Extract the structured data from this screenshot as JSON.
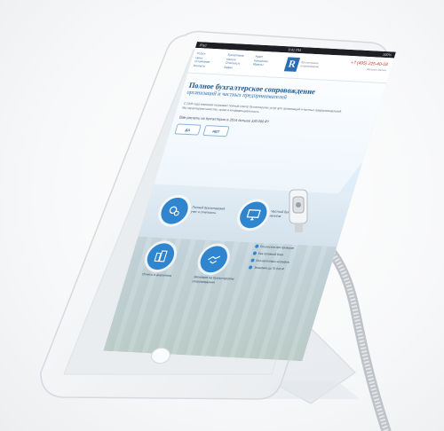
{
  "status_bar": {
    "carrier": "iPad",
    "time": "9:41 PM",
    "battery": "100%"
  },
  "nav": {
    "col1": [
      "Услуги",
      "Цены",
      "О компании",
      "Контакты"
    ],
    "col2": [
      "Бухгалтерия",
      "Налоги",
      "Отчетность",
      "Кадры"
    ],
    "col3": [
      "Аудит",
      "Консалтинг",
      "Юристы"
    ],
    "logo_letter": "R",
    "logo_caption": [
      "бухгалтерское",
      "сопровождение"
    ],
    "phone": "+7 (495) 225-40-18",
    "phone_note": "Заказать звонок"
  },
  "hero": {
    "title": "Полное бухгалтерское сопровождение",
    "subtitle": "организаций и частных предпринимателей",
    "text": "С 2006 года компания оказывает полный спектр бухгалтерских услуг для организаций и частных предпринимателей. Мы гарантируем качество, сроки и конфиденциальность.",
    "question": "Вам расчеты на бухгалтерию в 2014 больше 320 000 ₽?",
    "btn_yes": "ДА",
    "btn_no": "НЕТ"
  },
  "features": [
    {
      "label": "Полный бухгалтерский учет и отчетность",
      "icon": "gears-icon"
    },
    {
      "label": "Частный бухгалтер без налогов",
      "icon": "monitor-icon"
    },
    {
      "label": "Отчеты и аналитика",
      "icon": "buildings-icon"
    },
    {
      "label": "Экономия на бухгалтерском сопровождении",
      "icon": "handshake-icon"
    }
  ],
  "checks": [
    "Без рисков при проверке",
    "Без головной боли",
    "Без налоговых штрафов",
    "Экономия до 70 000 ₽"
  ],
  "colors": {
    "accent": "#2f86cf",
    "title": "#1e5a96",
    "phone": "#c0392b"
  }
}
